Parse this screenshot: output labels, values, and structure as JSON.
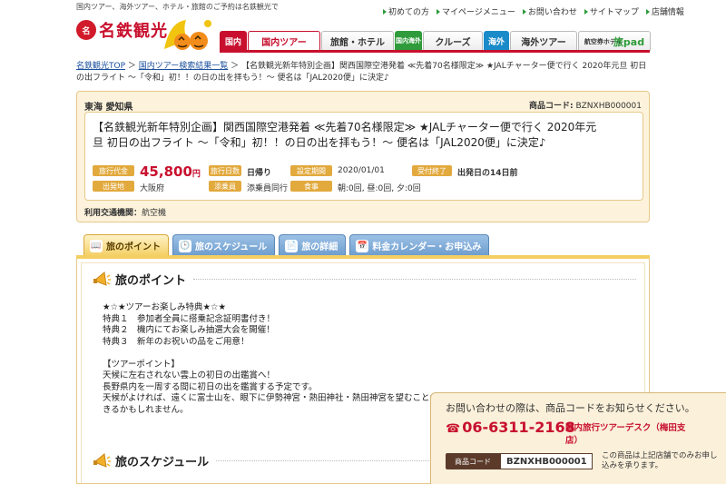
{
  "header": {
    "tagline": "国内ツアー、海外ツアー、ホテル・旅館のご予約は名鉄観光で",
    "logo_mark": "名",
    "logo_name": "名鉄観光",
    "utility_links": [
      "初めての方",
      "マイページメニュー",
      "お問い合わせ",
      "サイトマップ",
      "店舗情報"
    ]
  },
  "nav": {
    "domestic_tag": "国内",
    "domestic_tour": "国内ツアー",
    "ryokan_hotel": "旅館・ホテル",
    "overseas_domestic_tag": "国内海外",
    "cruise": "クルーズ",
    "overseas_tag": "海外",
    "overseas_tour": "海外ツアー",
    "airhotel_tag": "航空券ホテル",
    "tabipad": "旅pad"
  },
  "breadcrumb": {
    "home": "名鉄観光TOP",
    "list": "国内ツアー検索結果一覧",
    "current": "【名鉄観光新年特別企画】関西国際空港発着 ≪先着70名様限定≫ ★JALチャーター便で行く 2020年元旦 初日の出フライト ～「令和」初！！の日の出を拝もう！～ 便名は「JAL2020便」に決定♪"
  },
  "product": {
    "region": "東海 愛知県",
    "code_label": "商品コード:",
    "code": "BZNXHB000001",
    "title": "【名鉄観光新年特別企画】関西国際空港発着 ≪先着70名様限定≫ ★JALチャーター便で行く 2020年元旦 初日の出フライト ～「令和」初！！の日の出を拝もう！～ 便名は「JAL2020便」に決定♪",
    "price_label": "旅行代金",
    "price": "45,800",
    "price_unit": "円",
    "days_label": "旅行日数",
    "days": "日帰り",
    "period_label": "設定期間",
    "period": "2020/01/01",
    "deadline_label": "受付終了",
    "deadline": "出発日の14日前",
    "departure_label": "出発地",
    "departure": "大阪府",
    "conductor_label": "添乗員",
    "conductor": "添乗員同行",
    "meals_label": "食事",
    "meals": "朝:0回, 昼:0回, 夕:0回",
    "transport_label": "利用交通機関：",
    "transport": "航空機"
  },
  "tabs": [
    "旅のポイント",
    "旅のスケジュール",
    "旅の詳細",
    "料金カレンダー・お申込み"
  ],
  "content": {
    "points_title": "旅のポイント",
    "points": [
      "★☆★ツアーお楽しみ特典★☆★",
      "特典１　参加者全員に搭乗記念証明書付き！",
      "特典２　機内にてお楽しみ抽選大会を開催！",
      "特典３　新年のお祝いの品をご用意！",
      "",
      "【ツアーポイント】",
      "天候に左右されない雲上の初日の出鑑賞へ！",
      "長野県内を一周する間に初日の出を鑑賞する予定です。",
      "天候がよければ、遠くに富士山を、眼下に伊勢神宮・熱田神社・熱田神宮を望むことがで",
      "きるかもしれません。"
    ],
    "schedule_title": "旅のスケジュール"
  },
  "contact": {
    "message": "お問い合わせの際は、商品コードをお知らせください。",
    "tel": "06-6311-2168",
    "desk": "国内旅行ツアーデスク（梅田支店）",
    "code_label": "商品コード",
    "code": "BZNXHB000001",
    "note": "この商品は上記店舗でのみお申し込みを承ります。"
  },
  "colors": {
    "brand_red": "#c8102e",
    "label_orange": "#e2a93d",
    "tab_blue": "#6d9ccd",
    "tab_active": "#f3cf63"
  }
}
